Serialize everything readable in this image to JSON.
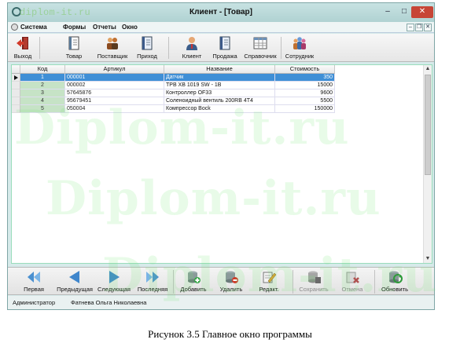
{
  "window": {
    "watermark_url": "diplom-it.ru",
    "title": "Клиент - [Товар]",
    "minimize": "–",
    "maximize": "□",
    "close": "✕"
  },
  "menu": {
    "items": [
      "Система",
      "Формы",
      "Отчеты",
      "Окно"
    ],
    "mdi_min": "–",
    "mdi_restore": "❐",
    "mdi_close": "✕"
  },
  "toolbar": {
    "items": [
      {
        "label": "Выход",
        "icon": "exit-door-icon"
      },
      {
        "label": "Товар",
        "icon": "book-icon"
      },
      {
        "label": "Поставщик",
        "icon": "supplier-people-icon"
      },
      {
        "label": "Приход",
        "icon": "notebook-icon"
      },
      {
        "label": "Клиент",
        "icon": "client-person-icon"
      },
      {
        "label": "Продажа",
        "icon": "notebook-icon"
      },
      {
        "label": "Справочник",
        "icon": "grid-table-icon"
      },
      {
        "label": "Сотрудник",
        "icon": "employees-group-icon"
      }
    ]
  },
  "table": {
    "columns": [
      "Код",
      "Артикул",
      "Название",
      "Стоимость"
    ],
    "rows": [
      {
        "code": "1",
        "article": "000001",
        "name": "Датчик",
        "cost": "350"
      },
      {
        "code": "2",
        "article": "000002",
        "name": "ТРВ ХВ 1019 SW - 1В",
        "cost": "15000"
      },
      {
        "code": "3",
        "article": "57645876",
        "name": "Контроллер ОF33",
        "cost": "9600"
      },
      {
        "code": "4",
        "article": "95679451",
        "name": "Соленоидный вентиль 200RB 4Т4",
        "cost": "5500"
      },
      {
        "code": "5",
        "article": "050004",
        "name": "Компрессор Bock",
        "cost": "150000"
      }
    ],
    "selected_row": 1
  },
  "scroll": {
    "up": "▲",
    "down": "▼"
  },
  "nav": {
    "items": [
      {
        "label": "Первая",
        "icon": "first-record-icon",
        "enabled": true
      },
      {
        "label": "Предыдущая",
        "icon": "previous-record-icon",
        "enabled": true
      },
      {
        "label": "Следующая",
        "icon": "next-record-icon",
        "enabled": true
      },
      {
        "label": "Последняя",
        "icon": "last-record-icon",
        "enabled": true
      },
      {
        "label": "Добавить",
        "icon": "db-add-icon",
        "enabled": true
      },
      {
        "label": "Удалить",
        "icon": "db-delete-icon",
        "enabled": true
      },
      {
        "label": "Редакт.",
        "icon": "edit-pencil-icon",
        "enabled": true
      },
      {
        "label": "Сохранить",
        "icon": "db-save-icon",
        "enabled": false
      },
      {
        "label": "Отмена",
        "icon": "cancel-icon",
        "enabled": false
      },
      {
        "label": "Обновить",
        "icon": "refresh-icon",
        "enabled": true
      }
    ]
  },
  "status": {
    "role": "Администратор",
    "user": "Фатнева Ольга Николаевна"
  },
  "watermark": "Diplom-it.ru",
  "caption": "Рисунок 3.5 Главное окно программы",
  "colors": {
    "selection": "#3f8fd6",
    "close_button": "#c74536",
    "code_cell": "#c6e3c6"
  }
}
